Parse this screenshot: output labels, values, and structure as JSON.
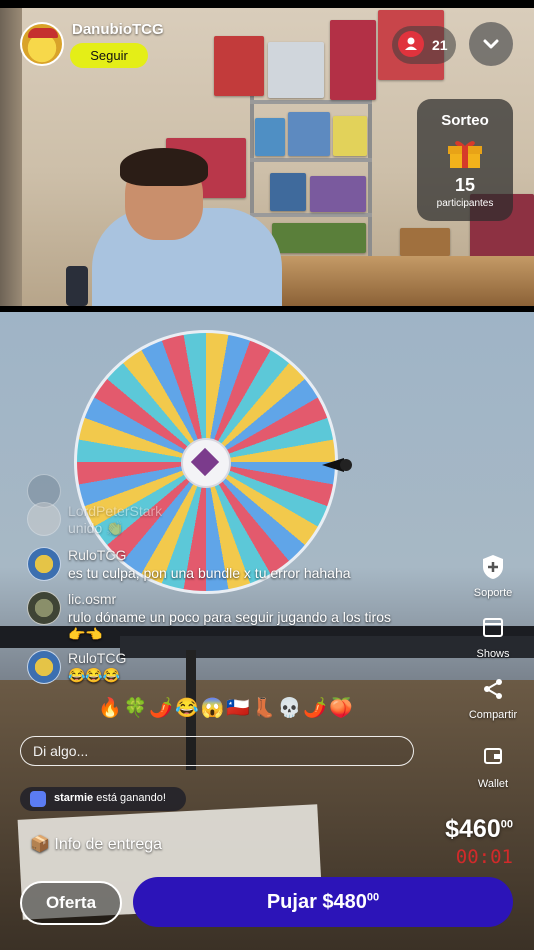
{
  "header": {
    "streamer_name": "DanubioTCG",
    "follow_label": "Seguir",
    "viewer_count": "21"
  },
  "giveaway": {
    "title": "Sorteo",
    "count": "15",
    "label": "participantes"
  },
  "chat": {
    "messages": [
      {
        "user": "LordPeterStark",
        "text": "unido 👏"
      },
      {
        "user": "RuloTCG",
        "text": "es tu culpa, pon una bundle x tu error hahaha"
      },
      {
        "user": "lic.osmr",
        "text": "rulo dóname un poco para seguir jugando a los tiros👉👈"
      },
      {
        "user": "RuloTCG",
        "text": "😂😂😂"
      }
    ]
  },
  "reactions": [
    "🔥",
    "🍀",
    "🌶️",
    "😂",
    "😱",
    "🇨🇱",
    "👢",
    "💀",
    "🌶️",
    "🍑"
  ],
  "side_actions": {
    "support": "Soporte",
    "shows": "Shows",
    "share": "Compartir",
    "wallet": "Wallet"
  },
  "input": {
    "placeholder": "Di algo..."
  },
  "winner": {
    "user": "starmie",
    "text": "está ganando!"
  },
  "delivery": {
    "label": "Info de entrega",
    "icon": "📦"
  },
  "auction": {
    "price_main": "$460",
    "price_cents": "00",
    "timer": "00:01",
    "offer_label": "Oferta",
    "bid_label": "Pujar $480",
    "bid_cents": "00"
  },
  "colors": {
    "follow_bg": "#e4ee17",
    "bid_bg": "#2c14b8",
    "timer": "#d12a2a",
    "viewer_icon": "#e0333d"
  }
}
